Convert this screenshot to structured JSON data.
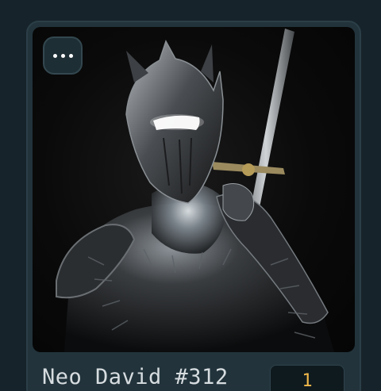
{
  "card": {
    "title": "Neo David #312",
    "count": "1",
    "menu_icon": "more-horizontal-icon",
    "image_alt": "armored knight holding a sword"
  },
  "colors": {
    "background": "#17232a",
    "card": "#22333b",
    "title_text": "#d7dde0",
    "count_text": "#f0b84a",
    "badge_bg": "#0f1a1f"
  }
}
